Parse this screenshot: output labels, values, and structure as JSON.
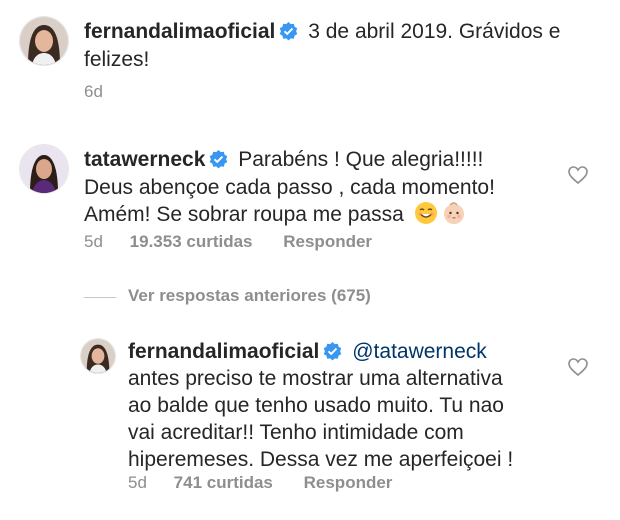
{
  "post": {
    "username": "fernandalimaoficial",
    "caption_line1": "3 de abril 2019. Grávidos e",
    "caption_line2": "felizes!",
    "time": "6d"
  },
  "comment1": {
    "username": "tatawerneck",
    "line1": "Parabéns ! Que alegria!!!!!",
    "line2": "Deus abençoe cada passo , cada momento!",
    "line3": "Amém! Se sobrar roupa me passa",
    "emojis": [
      "smiling-face-icon",
      "baby-icon"
    ],
    "time": "5d",
    "likes": "19.353 curtidas",
    "reply_label": "Responder"
  },
  "view_replies": {
    "label": "Ver respostas anteriores (675)"
  },
  "reply1": {
    "username": "fernandalimaoficial",
    "mention": "@tatawerneck",
    "line2": "antes preciso te mostrar uma alternativa",
    "line3": "ao balde que tenho usado muito. Tu nao",
    "line4": "vai acreditar!! Tenho intimidade com",
    "line5": "hiperemeses. Dessa vez me aperfeiçoei !",
    "time": "5d",
    "likes": "741 curtidas",
    "reply_label": "Responder"
  },
  "colors": {
    "text": "#262626",
    "meta": "#8e8e8e",
    "verified": "#3897f0",
    "mention": "#003569"
  }
}
